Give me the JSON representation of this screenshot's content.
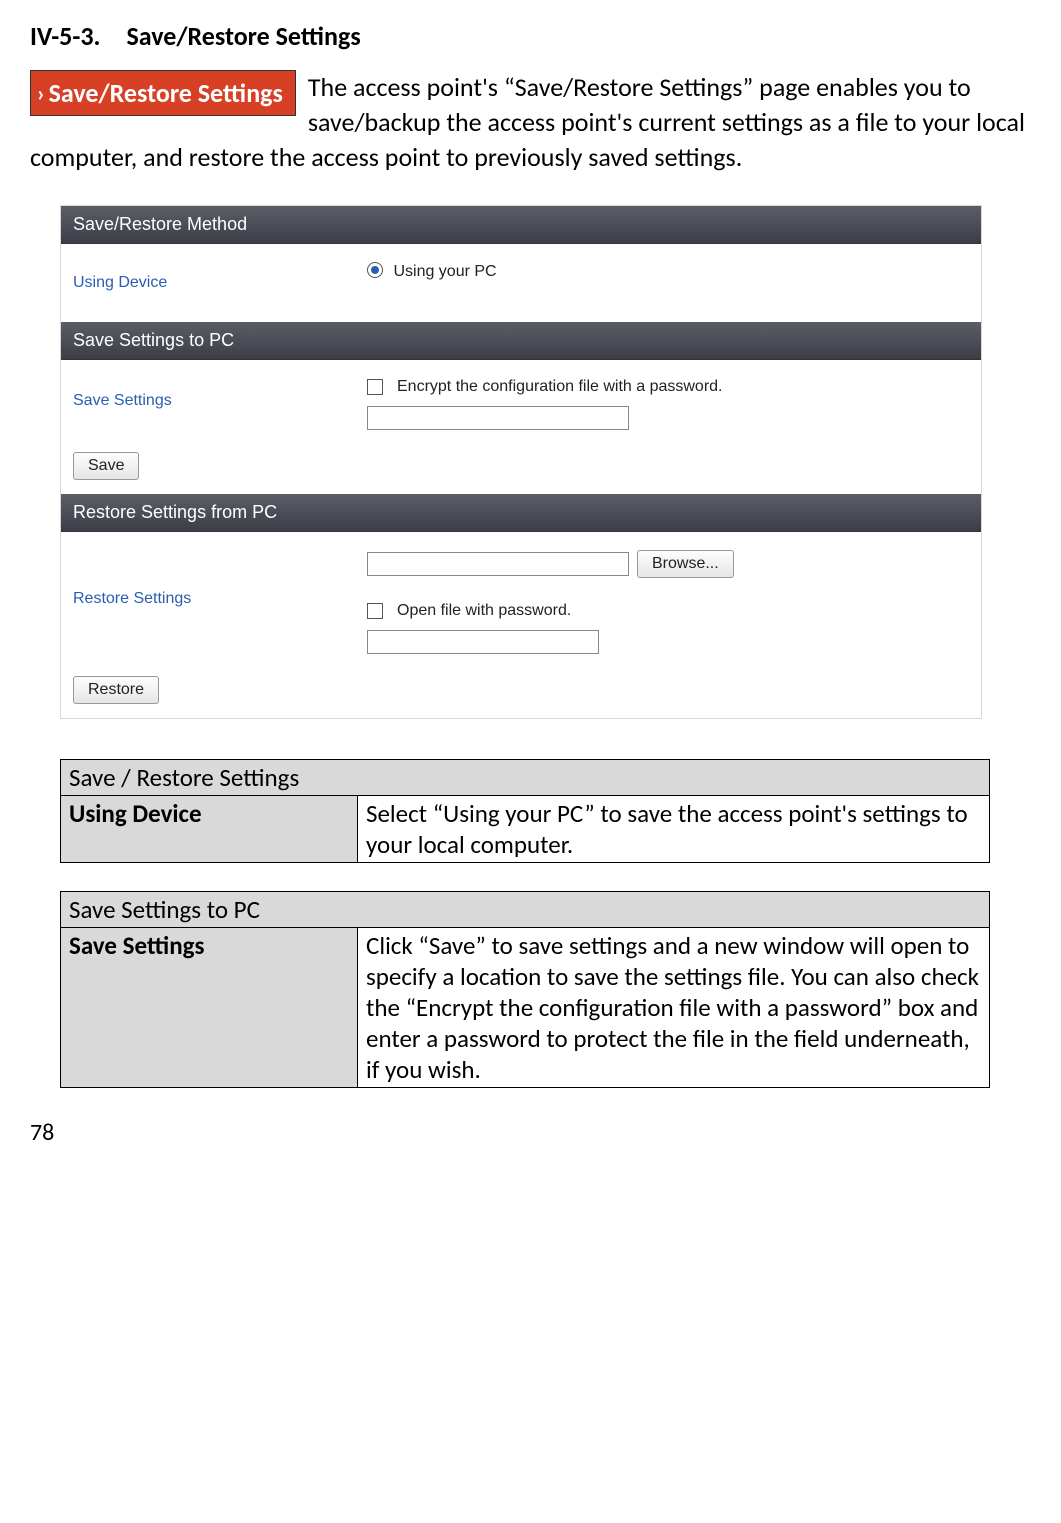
{
  "heading": "IV-5-3. Save/Restore Settings",
  "nav_badge": "Save/Restore Settings",
  "intro": "The access point's “Save/Restore Settings” page enables you to save/backup the access point's current settings as a file to your local computer, and restore the access point to previously saved settings.",
  "panel": {
    "method": {
      "title": "Save/Restore Method",
      "left_label": "Using Device",
      "radio_label": "Using your PC"
    },
    "save": {
      "title": "Save Settings to PC",
      "left_label": "Save Settings",
      "encrypt_label": "Encrypt the configuration file with a password.",
      "button": "Save"
    },
    "restore": {
      "title": "Restore Settings from PC",
      "left_label": "Restore Settings",
      "browse_button": "Browse...",
      "open_label": "Open file with password.",
      "button": "Restore"
    }
  },
  "table1": {
    "title": "Save / Restore Settings",
    "row_label": "Using Device",
    "row_desc": "Select “Using your PC” to save the access point's settings to your local computer."
  },
  "table2": {
    "title": "Save Settings to PC",
    "row_label": "Save Settings",
    "row_desc": "Click “Save” to save settings and a new window will open to specify a location to save the settings file. You can also check the “Encrypt the configuration file with a password” box and enter a password to protect the file in the field underneath, if you wish."
  },
  "page_number": "78"
}
